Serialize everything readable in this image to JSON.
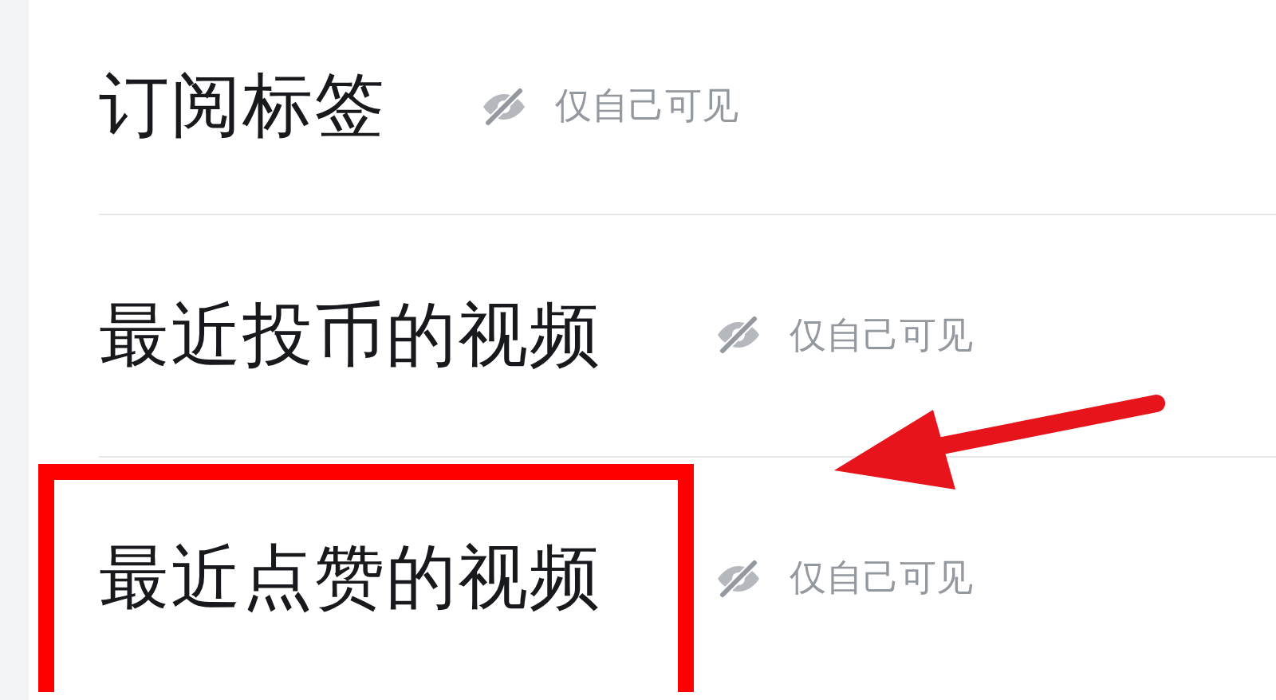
{
  "rows": [
    {
      "title": "订阅标签",
      "visibility": "仅自己可见",
      "highlighted": false
    },
    {
      "title": "最近投币的视频",
      "visibility": "仅自己可见",
      "highlighted": false
    },
    {
      "title": "最近点赞的视频",
      "visibility": "仅自己可见",
      "highlighted": true
    }
  ]
}
